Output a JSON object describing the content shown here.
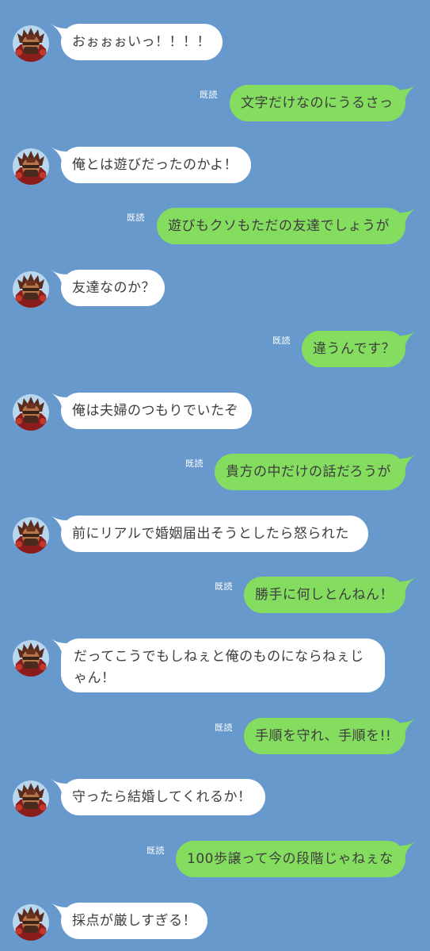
{
  "theme": {
    "background": "#6799cd",
    "incoming_bubble": "#ffffff",
    "outgoing_bubble": "#85dd60",
    "text": "#3d3d3d"
  },
  "read_label": "既読",
  "messages": [
    {
      "side": "in",
      "text": "おぉぉぉいっ！！！！"
    },
    {
      "side": "out",
      "text": "文字だけなのにうるさっ"
    },
    {
      "side": "in",
      "text": "俺とは遊びだったのかよ！"
    },
    {
      "side": "out",
      "text": "遊びもクソもただの友達でしょうが"
    },
    {
      "side": "in",
      "text": "友達なのか？"
    },
    {
      "side": "out",
      "text": "違うんです？"
    },
    {
      "side": "in",
      "text": "俺は夫婦のつもりでいたぞ"
    },
    {
      "side": "out",
      "text": "貴方の中だけの話だろうが"
    },
    {
      "side": "in",
      "text": "前にリアルで婚姻届出そうとしたら怒られた"
    },
    {
      "side": "out",
      "text": "勝手に何しとんねん！"
    },
    {
      "side": "in",
      "text": "だってこうでもしねぇと俺のものにならねぇじゃん！"
    },
    {
      "side": "out",
      "text": "手順を守れ、手順を!!"
    },
    {
      "side": "in",
      "text": "守ったら結婚してくれるか！"
    },
    {
      "side": "out",
      "text": "100歩譲って今の段階じゃねぇな"
    },
    {
      "side": "in",
      "text": "採点が厳しすぎる！"
    }
  ]
}
